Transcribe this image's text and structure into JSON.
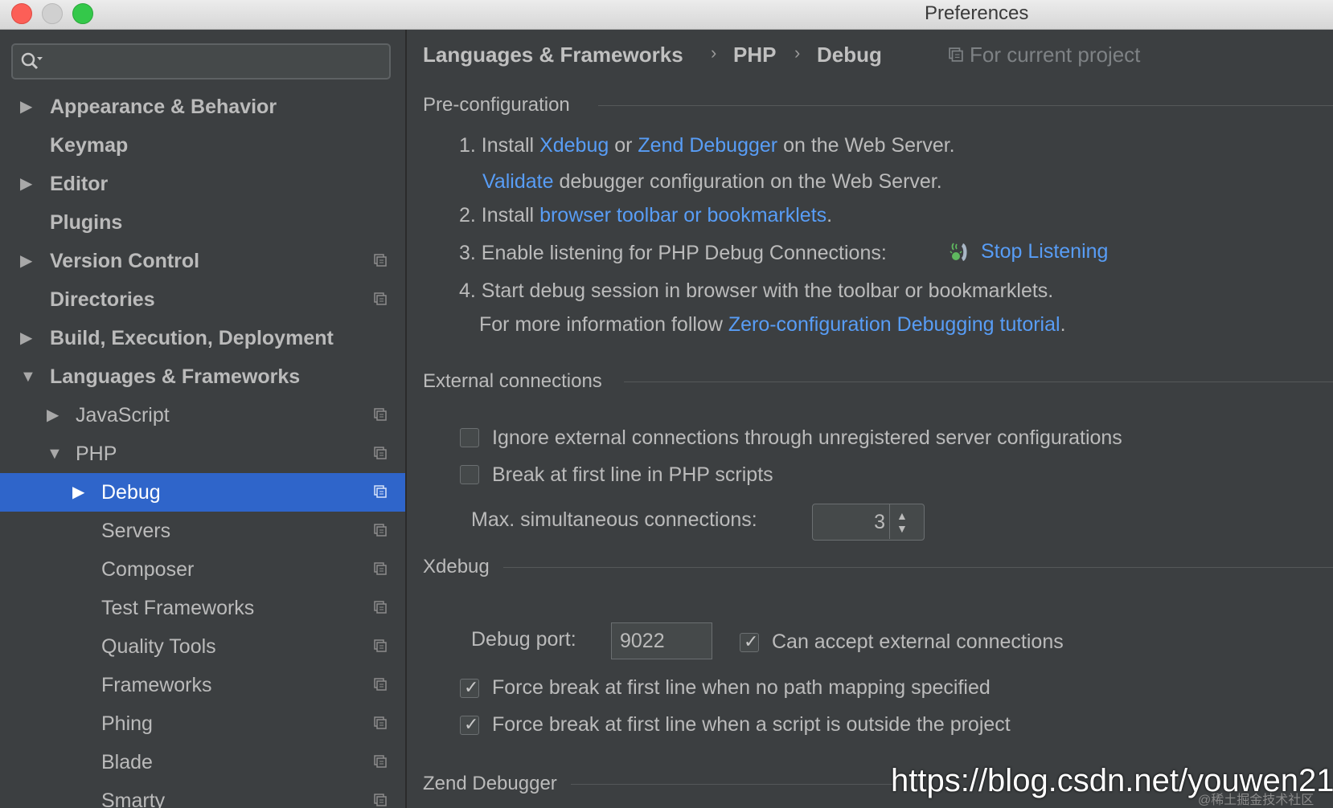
{
  "window": {
    "title": "Preferences"
  },
  "search": {
    "placeholder": ""
  },
  "sidebar": {
    "items": [
      {
        "label": "Appearance & Behavior",
        "arrow": "▶"
      },
      {
        "label": "Keymap"
      },
      {
        "label": "Editor",
        "arrow": "▶"
      },
      {
        "label": "Plugins"
      },
      {
        "label": "Version Control",
        "arrow": "▶"
      },
      {
        "label": "Directories"
      },
      {
        "label": "Build, Execution, Deployment",
        "arrow": "▶"
      },
      {
        "label": "Languages & Frameworks",
        "arrow": "▼"
      },
      {
        "label": "JavaScript",
        "arrow": "▶"
      },
      {
        "label": "PHP",
        "arrow": "▼"
      },
      {
        "label": "Debug",
        "arrow": "▶"
      },
      {
        "label": "Servers"
      },
      {
        "label": "Composer"
      },
      {
        "label": "Test Frameworks"
      },
      {
        "label": "Quality Tools"
      },
      {
        "label": "Frameworks"
      },
      {
        "label": "Phing"
      },
      {
        "label": "Blade"
      },
      {
        "label": "Smarty"
      }
    ]
  },
  "breadcrumb": {
    "parts": [
      "Languages & Frameworks",
      "PHP",
      "Debug"
    ],
    "separator": "›",
    "scope": "For current project"
  },
  "preconfig": {
    "title": "Pre-configuration",
    "step1_prefix": "1. Install ",
    "step1_link1": "Xdebug",
    "step1_or": " or ",
    "step1_link2": "Zend Debugger",
    "step1_suffix": " on the Web Server.",
    "validate_link": "Validate",
    "validate_suffix": " debugger configuration on the Web Server.",
    "step2_prefix": "2. Install ",
    "step2_link": "browser toolbar or bookmarklets",
    "step2_suffix": ".",
    "step3_prefix": "3. Enable listening for PHP Debug Connections: ",
    "step3_link": "Stop Listening",
    "step4": "4. Start debug session in browser with the toolbar or bookmarklets.",
    "more_prefix": "For more information follow ",
    "more_link": "Zero-configuration Debugging tutorial",
    "more_suffix": "."
  },
  "external": {
    "title": "External connections",
    "ignore_label": "Ignore external connections through unregistered server configurations",
    "break_label": "Break at first line in PHP scripts",
    "max_label": "Max. simultaneous connections:",
    "max_value": "3"
  },
  "xdebug": {
    "title": "Xdebug",
    "port_label": "Debug port:",
    "port_value": "9022",
    "accept_label": "Can accept external connections",
    "force_nomap_label": "Force break at first line when no path mapping specified",
    "force_outside_label": "Force break at first line when a script is outside the project"
  },
  "zend": {
    "title": "Zend Debugger"
  },
  "watermark": {
    "url": "https://blog.csdn.net/youwen21",
    "small": "@稀土掘金技术社区"
  },
  "colors": {
    "accent": "#2f65ca",
    "link": "#589df6",
    "background": "#3c3f41"
  }
}
